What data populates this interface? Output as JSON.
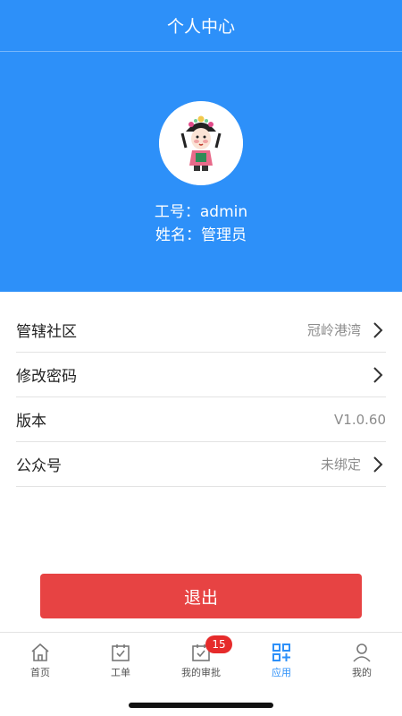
{
  "header": {
    "title": "个人中心",
    "employee_id": "工号：admin",
    "name": "姓名：管理员",
    "background_color": "#2d90f9"
  },
  "settings": [
    {
      "label": "管辖社区",
      "value": "冠岭港湾",
      "chevron": true
    },
    {
      "label": "修改密码",
      "value": "",
      "chevron": true
    },
    {
      "label": "版本",
      "value": "V1.0.60",
      "chevron": false
    },
    {
      "label": "公众号",
      "value": "未绑定",
      "chevron": true
    }
  ],
  "logout": {
    "label": "退出",
    "color": "#e74343"
  },
  "tabbar": {
    "active_color": "#2d90f9",
    "items": [
      {
        "label": "首页",
        "icon": "home-icon"
      },
      {
        "label": "工单",
        "icon": "calendar-check-icon"
      },
      {
        "label": "我的审批",
        "icon": "approval-check-icon",
        "badge": "15"
      },
      {
        "label": "应用",
        "icon": "apps-grid-icon",
        "active": true
      },
      {
        "label": "我的",
        "icon": "user-icon"
      }
    ]
  }
}
